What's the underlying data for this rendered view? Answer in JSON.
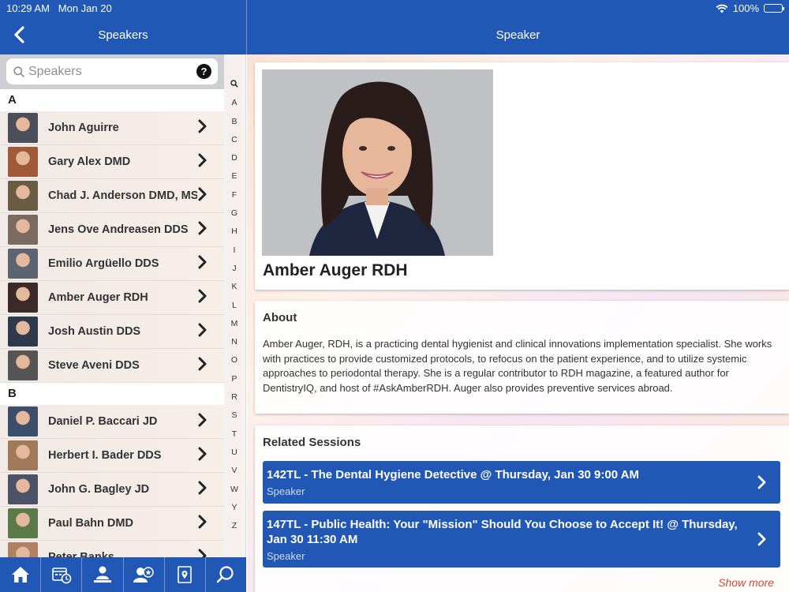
{
  "status": {
    "time": "10:29 AM",
    "date": "Mon Jan 20",
    "battery": "100%",
    "battery_level": 1.0
  },
  "nav": {
    "left_title": "Speakers",
    "right_title": "Speaker"
  },
  "search": {
    "placeholder": "Speakers",
    "help_label": "?"
  },
  "index_letters": [
    "A",
    "B",
    "C",
    "D",
    "E",
    "F",
    "G",
    "H",
    "I",
    "J",
    "K",
    "L",
    "M",
    "N",
    "O",
    "P",
    "R",
    "S",
    "T",
    "U",
    "V",
    "W",
    "Y",
    "Z"
  ],
  "sections": [
    {
      "letter": "A",
      "speakers": [
        {
          "name": "John Aguirre",
          "avatar_color": "#4a4f5a"
        },
        {
          "name": "Gary Alex DMD",
          "avatar_color": "#a05a3a"
        },
        {
          "name": "Chad J. Anderson DMD, MS",
          "avatar_color": "#6b5a44"
        },
        {
          "name": "Jens Ove Andreasen DDS",
          "avatar_color": "#7a6a62"
        },
        {
          "name": "Emilio Argüello DDS",
          "avatar_color": "#5b6470"
        },
        {
          "name": "Amber Auger RDH",
          "avatar_color": "#3b2a28"
        },
        {
          "name": "Josh Austin DDS",
          "avatar_color": "#2f3a4d"
        },
        {
          "name": "Steve Aveni DDS",
          "avatar_color": "#555"
        }
      ]
    },
    {
      "letter": "B",
      "speakers": [
        {
          "name": "Daniel P. Baccari JD",
          "avatar_color": "#3c4e6a"
        },
        {
          "name": "Herbert I. Bader DDS",
          "avatar_color": "#a07a58"
        },
        {
          "name": "John G. Bagley JD",
          "avatar_color": "#4d5366"
        },
        {
          "name": "Paul Bahn DMD",
          "avatar_color": "#5a7a4a"
        },
        {
          "name": "Peter Banks",
          "avatar_color": "#b08060"
        }
      ]
    }
  ],
  "speaker": {
    "name": "Amber Auger RDH",
    "about_title": "About",
    "about": "Amber Auger, RDH, is a practicing dental hygienist and clinical innovations implementation specialist. She works with practices to provide customized protocols, to refocus on the patient experience, and to utilize systemic approaches to periodontal therapy. She is a regular contributor to RDH magazine, a featured author for DentistryIQ, and host of #AskAmberRDH. Auger also provides preventive services abroad.",
    "sessions_title": "Related Sessions",
    "sessions": [
      {
        "title": "142TL - The Dental Hygiene Detective @ Thursday, Jan 30 9:00 AM",
        "role": "Speaker"
      },
      {
        "title": "147TL - Public Health: Your \"Mission\" Should You Choose to Accept It! @ Thursday, Jan 30 11:30 AM",
        "role": "Speaker"
      }
    ],
    "show_more": "Show more"
  },
  "tabs": [
    "home-icon",
    "schedule-icon",
    "attendee-icon",
    "speaker-icon",
    "map-icon",
    "search-icon"
  ],
  "colors": {
    "brand_blue": "#2157b5",
    "show_more": "#d04a3a"
  }
}
